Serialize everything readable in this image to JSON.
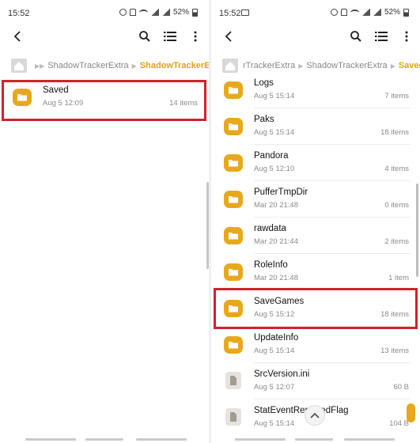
{
  "colors": {
    "accent": "#e0a21b",
    "highlight": "#d0222a",
    "folder": "#e8a81c"
  },
  "left": {
    "status": {
      "time": "15:52",
      "battery": "52%"
    },
    "toolbar": {
      "icons": [
        "back-icon",
        "search-icon",
        "list-view-icon",
        "more-icon"
      ]
    },
    "breadcrumb": [
      "ShadowTrackerExtra",
      "ShadowTrackerExtra"
    ],
    "items": [
      {
        "name": "Saved",
        "date": "Aug 5 12:09",
        "count": "14 items",
        "type": "folder"
      }
    ]
  },
  "right": {
    "status": {
      "time": "15:52",
      "battery": "52%"
    },
    "toolbar": {
      "icons": [
        "back-icon",
        "search-icon",
        "list-view-icon",
        "more-icon"
      ]
    },
    "breadcrumb": [
      "rTrackerExtra",
      "ShadowTrackerExtra",
      "Saved"
    ],
    "items": [
      {
        "name": "Logs",
        "date": "Aug 5 15:14",
        "count": "7 items",
        "type": "folder"
      },
      {
        "name": "Paks",
        "date": "Aug 5 15:14",
        "count": "18 items",
        "type": "folder"
      },
      {
        "name": "Pandora",
        "date": "Aug 5 12:10",
        "count": "4 items",
        "type": "folder"
      },
      {
        "name": "PufferTmpDir",
        "date": "Mar 20 21:48",
        "count": "0 items",
        "type": "folder"
      },
      {
        "name": "rawdata",
        "date": "Mar 20 21:44",
        "count": "2 items",
        "type": "folder"
      },
      {
        "name": "RoleInfo",
        "date": "Mar 20 21:48",
        "count": "1 item",
        "type": "folder"
      },
      {
        "name": "SaveGames",
        "date": "Aug 5 15:12",
        "count": "18 items",
        "type": "folder"
      },
      {
        "name": "UpdateInfo",
        "date": "Aug 5 15:14",
        "count": "13 items",
        "type": "folder"
      },
      {
        "name": "SrcVersion.ini",
        "date": "Aug 5 12:07",
        "count": "60 B",
        "type": "file"
      },
      {
        "name": "StatEventReportedFlag",
        "date": "Aug 5 15:14",
        "count": "104 B",
        "type": "file"
      }
    ]
  }
}
